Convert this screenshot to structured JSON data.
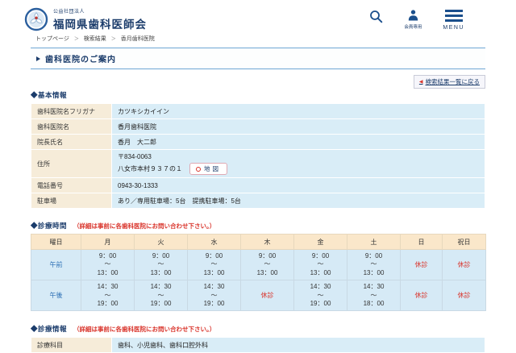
{
  "colors": {
    "brand_navy": "#1b3c6b",
    "icon_blue": "#1b4f8c",
    "alert_red": "#d9342b",
    "label_cell_bg": "#f6ecd9",
    "value_cell_bg": "#d9edf7",
    "hours_header_bg": "#fae7ca",
    "hours_body_bg": "#d6eaf6",
    "title_rule_blue": "#6ea7d4"
  },
  "header": {
    "org_type": "公益社団法人",
    "org_name": "福岡県歯科医師会",
    "members_label": "会員専用",
    "menu_label": "MENU"
  },
  "breadcrumb": {
    "separator": "＞",
    "items": [
      "トップページ",
      "検索結果",
      "香月歯科医院"
    ]
  },
  "page": {
    "title": "歯科医院のご案内",
    "back_link_arrow": "◀",
    "back_link_label": "検索結果一覧に戻る"
  },
  "basic_info": {
    "heading": "◆基本情報",
    "rows": [
      {
        "label": "歯科医院名フリガナ",
        "value": "カツキシカイイン"
      },
      {
        "label": "歯科医院名",
        "value": "香月歯科医院"
      },
      {
        "label": "院長氏名",
        "value": "香月　大二郎"
      },
      {
        "label": "電話番号",
        "value": "0943-30-1333"
      },
      {
        "label": "駐車場",
        "value": "あり／専用駐車場：5台　提携駐車場：5台"
      }
    ],
    "address": {
      "label": "住所",
      "postal_code": "〒834-0063",
      "street": "八女市本村９３７の１",
      "map_button_label": "地図"
    }
  },
  "hours": {
    "heading": "◆診療時間",
    "note": "（詳細は事前に各歯科医院にお問い合わせ下さい。）",
    "closed_label": "休診",
    "tilde": "～",
    "columns": [
      "曜日",
      "月",
      "火",
      "水",
      "木",
      "金",
      "土",
      "日",
      "祝日"
    ],
    "rows": [
      {
        "label": "午前",
        "cells": [
          {
            "from": "9：00",
            "to": "13：00"
          },
          {
            "from": "9：00",
            "to": "13：00"
          },
          {
            "from": "9：00",
            "to": "13：00"
          },
          {
            "from": "9：00",
            "to": "13：00"
          },
          {
            "from": "9：00",
            "to": "13：00"
          },
          {
            "from": "9：00",
            "to": "13：00"
          },
          {
            "closed": true
          },
          {
            "closed": true
          }
        ]
      },
      {
        "label": "午後",
        "cells": [
          {
            "from": "14：30",
            "to": "19：00"
          },
          {
            "from": "14：30",
            "to": "19：00"
          },
          {
            "from": "14：30",
            "to": "19：00"
          },
          {
            "closed": true
          },
          {
            "from": "14：30",
            "to": "19：00"
          },
          {
            "from": "14：30",
            "to": "18：00"
          },
          {
            "closed": true
          },
          {
            "closed": true
          }
        ]
      }
    ]
  },
  "clinical_info": {
    "heading": "◆診療情報",
    "note": "（詳細は事前に各歯科医院にお問い合わせ下さい。）",
    "rows": [
      {
        "label": "診療科目",
        "value": "歯科、小児歯科、歯科口腔外科"
      }
    ]
  }
}
